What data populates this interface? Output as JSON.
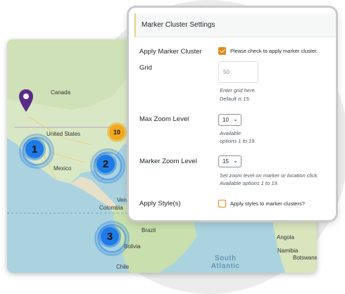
{
  "map": {
    "labels": {
      "canada": "Canada",
      "united_states": "United States",
      "mexico": "Mexico",
      "venezuela": "Vene",
      "colombia": "Colombia",
      "brazil": "Brazil",
      "bolivia": "Bolivia",
      "chile": "Chile",
      "angola": "Angola",
      "namibia": "Namibia",
      "botswana": "Botswana",
      "south_atlantic": "South\nAtlantic"
    },
    "clusters": [
      {
        "label": "1",
        "color": "#1e7be6"
      },
      {
        "label": "2",
        "color": "#1e7be6"
      },
      {
        "label": "3",
        "color": "#1e7be6"
      },
      {
        "label": "10",
        "color": "#f2a91b"
      }
    ],
    "pin_color": "#5b2a86"
  },
  "panel": {
    "title": "Marker Cluster Settings",
    "apply_cluster": {
      "label": "Apply Marker Cluster",
      "checked": true,
      "checkbox_text": "Please check to apply marker cluster."
    },
    "grid": {
      "label": "Grid",
      "placeholder": "50",
      "hint1": "Enter grid here.",
      "hint2": "Default is 15."
    },
    "max_zoom": {
      "label": "Max Zoom Level",
      "value": "10",
      "hint1": "Available",
      "hint2": "options 1 to 19."
    },
    "marker_zoom": {
      "label": "Marker Zoom Level",
      "value": "15",
      "hint1": "Set zoom level on marker or location click.",
      "hint2": "Available options 1 to 19."
    },
    "apply_styles": {
      "label": "Apply Style(s)",
      "checked": false,
      "checkbox_text": "Apply styles to marker clusters?"
    },
    "accent_color": "#e08a1e"
  }
}
